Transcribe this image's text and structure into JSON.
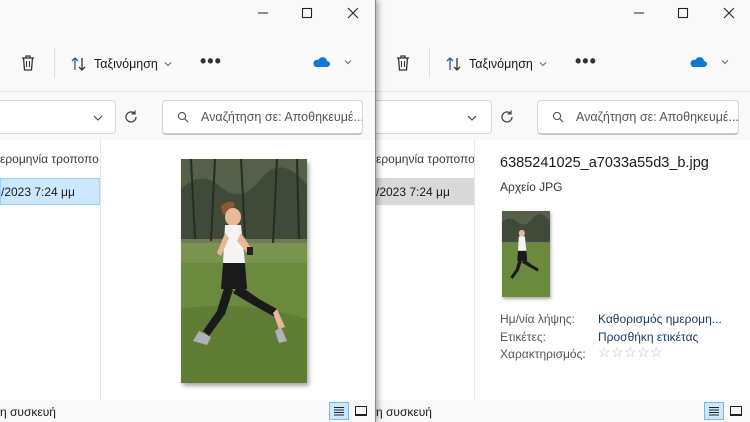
{
  "toolbar": {
    "sort_label": "Ταξινόμηση",
    "more_label": "•••"
  },
  "search": {
    "placeholder": "Αναζήτηση σε: Αποθηκευμέ..."
  },
  "list": {
    "date_header": "ερομηνία τροποπο",
    "date_value": "/2023 7:24 μμ"
  },
  "status": {
    "location": "η συσκευή"
  },
  "details": {
    "file_name": "6385241025_a7033a55d3_b.jpg",
    "file_type": "Αρχείο JPG",
    "properties": [
      {
        "label": "Ημ/νία λήψης:",
        "value": "Καθορισμός ημερομη..."
      },
      {
        "label": "Ετικέτες:",
        "value": "Προσθήκη ετικέτας"
      },
      {
        "label": "Χαρακτηρισμός:",
        "value": ""
      }
    ],
    "rating": {
      "value": 0,
      "max": 5
    }
  },
  "colors": {
    "accent": "#0067c0",
    "selection": "#cce8ff",
    "selection_gray": "#d9d9d9",
    "onedrive": "#0f78d4"
  }
}
